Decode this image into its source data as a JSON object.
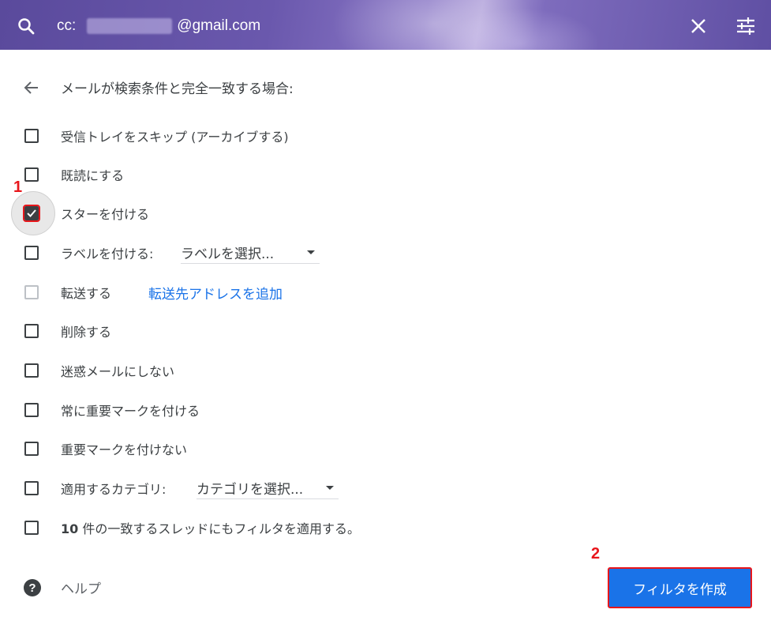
{
  "header": {
    "cc_label": "cc:",
    "email_domain": "@gmail.com",
    "search_icon": "search-icon",
    "close_icon": "close-icon",
    "tune_icon": "tune-icon"
  },
  "title": "メールが検索条件と完全一致する場合:",
  "actions": [
    {
      "label": "受信トレイをスキップ (アーカイブする)",
      "checked": false
    },
    {
      "label": "既読にする",
      "checked": false
    },
    {
      "label": "スターを付ける",
      "checked": true
    },
    {
      "label": "ラベルを付ける:",
      "checked": false,
      "select": "ラベルを選択..."
    },
    {
      "label": "転送する",
      "checked": false,
      "disabled": true,
      "link": "転送先アドレスを追加"
    },
    {
      "label": "削除する",
      "checked": false
    },
    {
      "label": "迷惑メールにしない",
      "checked": false
    },
    {
      "label": "常に重要マークを付ける",
      "checked": false
    },
    {
      "label": "重要マークを付けない",
      "checked": false
    },
    {
      "label": "適用するカテゴリ:",
      "checked": false,
      "select": "カテゴリを選択..."
    },
    {
      "label_bold": "10",
      "label": " 件の一致するスレッドにもフィルタを適用する。",
      "checked": false
    }
  ],
  "help_label": "ヘルプ",
  "create_button": "フィルタを作成",
  "annotations": {
    "marker1": "1",
    "marker2": "2"
  },
  "colors": {
    "accent": "#1a73e8",
    "annotation": "#e8161b"
  }
}
